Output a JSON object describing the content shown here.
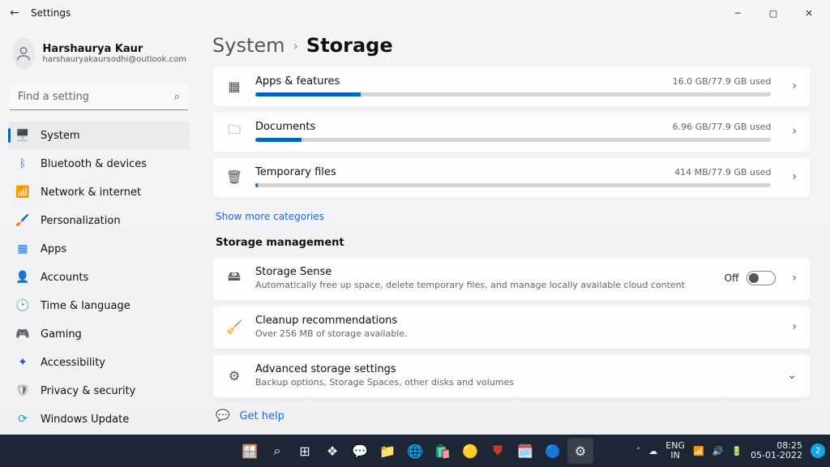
{
  "titlebar": {
    "title": "Settings"
  },
  "profile": {
    "name": "Harshaurya Kaur",
    "email": "harshauryakaursodhi@outlook.com"
  },
  "search": {
    "placeholder": "Find a setting"
  },
  "nav": [
    {
      "label": "System",
      "icon": "🖥️",
      "color": "#2b7cd3",
      "selected": true
    },
    {
      "label": "Bluetooth & devices",
      "icon": "ᛒ",
      "color": "#2b7cd3"
    },
    {
      "label": "Network & internet",
      "icon": "📶",
      "color": "#1aa3c9"
    },
    {
      "label": "Personalization",
      "icon": "🖌️",
      "color": "#c78a2a"
    },
    {
      "label": "Apps",
      "icon": "▦",
      "color": "#2b7cd3"
    },
    {
      "label": "Accounts",
      "icon": "👤",
      "color": "#3aa655"
    },
    {
      "label": "Time & language",
      "icon": "🕑",
      "color": "#4a8fe7"
    },
    {
      "label": "Gaming",
      "icon": "🎮",
      "color": "#777"
    },
    {
      "label": "Accessibility",
      "icon": "✦",
      "color": "#2b5fb3"
    },
    {
      "label": "Privacy & security",
      "icon": "🛡",
      "color": "#777"
    },
    {
      "label": "Windows Update",
      "icon": "⟳",
      "color": "#1aa3c9"
    }
  ],
  "breadcrumb": {
    "parent": "System",
    "current": "Storage"
  },
  "storage_items": [
    {
      "icon": "▦",
      "title": "Apps & features",
      "used": "16.0 GB/77.9 GB used",
      "pct": 20.5
    },
    {
      "icon": "🗀",
      "title": "Documents",
      "used": "6.96 GB/77.9 GB used",
      "pct": 8.9
    },
    {
      "icon": "🗑",
      "title": "Temporary files",
      "used": "414 MB/77.9 GB used",
      "pct": 0.5
    }
  ],
  "show_more": "Show more categories",
  "section_header": "Storage management",
  "mgmt": [
    {
      "icon": "🖴",
      "title": "Storage Sense",
      "sub": "Automatically free up space, delete temporary files, and manage locally available cloud content",
      "trail": "toggle",
      "toggle_text": "Off",
      "chev": "›"
    },
    {
      "icon": "🧹",
      "title": "Cleanup recommendations",
      "sub": "Over 256 MB of storage available.",
      "trail": "chev",
      "chev": "›"
    },
    {
      "icon": "⚙",
      "title": "Advanced storage settings",
      "sub": "Backup options, Storage Spaces, other disks and volumes",
      "trail": "chev",
      "chev": "⌄"
    }
  ],
  "help": {
    "label": "Get help"
  },
  "taskbar": {
    "lang1": "ENG",
    "lang2": "IN",
    "time": "08:25",
    "date": "05-01-2022",
    "notif": "2"
  }
}
